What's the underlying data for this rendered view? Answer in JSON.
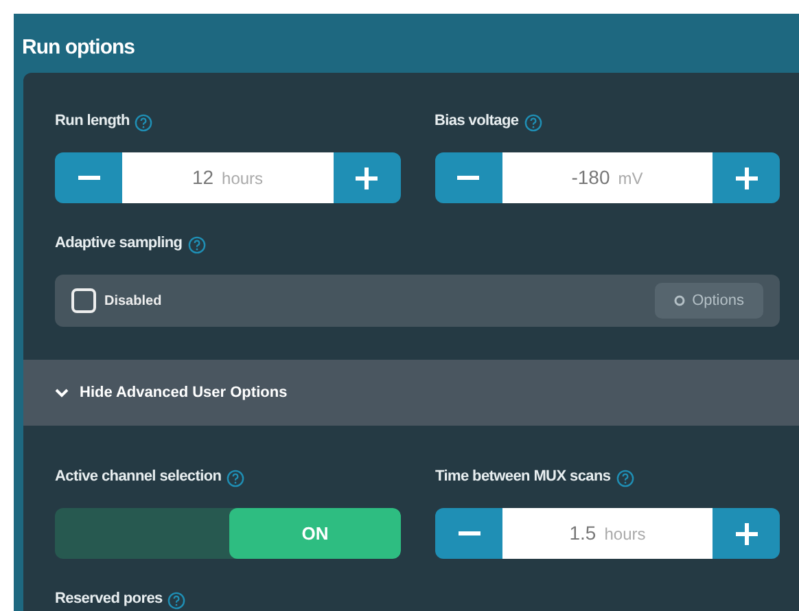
{
  "panel": {
    "title": "Run options"
  },
  "basic_fields": [
    {
      "kind": "stepper",
      "label": "Run length",
      "value": "12",
      "unit": "hours"
    },
    {
      "kind": "stepper",
      "label": "Bias voltage",
      "value": "-180",
      "unit": "mV"
    }
  ],
  "adaptive_sampling": {
    "label": "Adaptive sampling",
    "checkbox_label": "Disabled",
    "checked": false,
    "options_button": {
      "label": "Options",
      "disabled": true
    }
  },
  "advanced_toggle": {
    "label": "Hide Advanced User Options",
    "expanded": true
  },
  "advanced_fields": [
    {
      "kind": "switch",
      "label": "Active channel selection",
      "on": true,
      "state_label": "ON"
    },
    {
      "kind": "stepper",
      "label": "Time between MUX scans",
      "value": "1.5",
      "unit": "hours"
    }
  ],
  "reserved_pores": {
    "label": "Reserved pores"
  }
}
